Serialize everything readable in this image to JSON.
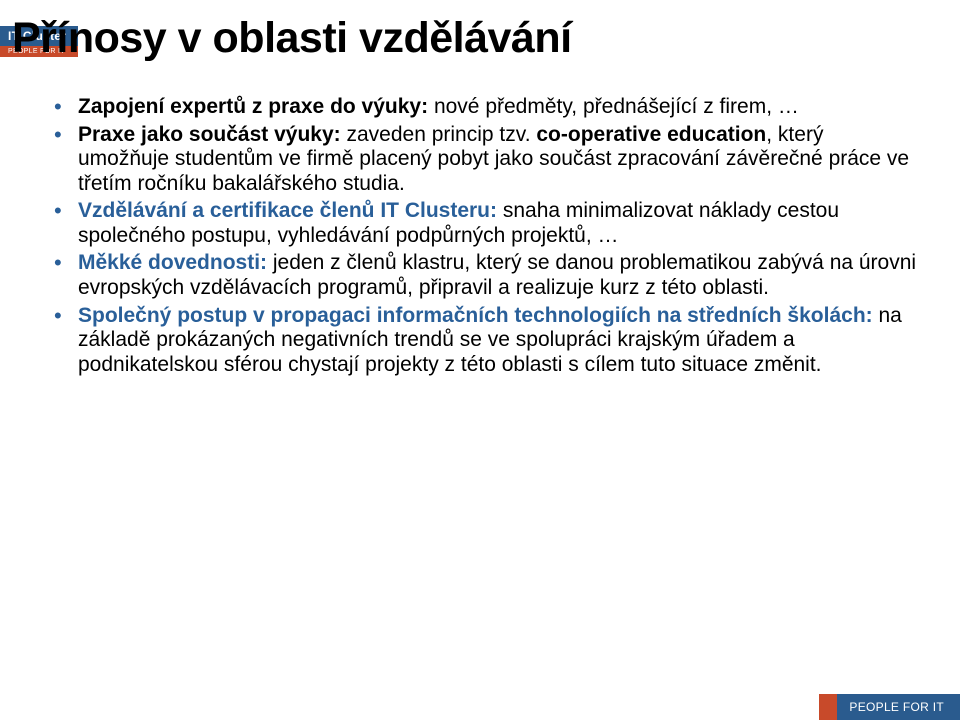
{
  "logo": {
    "top": "IT Cluster",
    "bottom": "PEOPLE FOR IT"
  },
  "title": "Přínosy v oblasti vzdělávání",
  "bullets": {
    "b0": {
      "head": "Zapojení expertů z praxe do výuky:",
      "tail": " nové předměty, přednášející z firem, …"
    },
    "b1": {
      "head": "Praxe jako součást výuky:",
      "tail": " zaveden princip tzv. ",
      "em": "co-operative education",
      "tail2": ", který umožňuje studentům ve firmě placený pobyt jako součást zpracování závěrečné práce ve třetím ročníku bakalářského studia."
    },
    "b2": {
      "head": "Vzdělávání a certifikace členů IT Clusteru:",
      "tail": " snaha minimalizovat náklady cestou společného postupu, vyhledávání podpůrných projektů, …"
    },
    "b3": {
      "head": "Měkké dovednosti:",
      "tail": " jeden z členů klastru, který se danou problematikou zabývá na úrovni evropských vzdělávacích programů, připravil a realizuje kurz z této oblasti."
    },
    "b4": {
      "head": "Společný postup v propagaci informačních technologiích na středních školách:",
      "tail": " na základě prokázaných negativních trendů se ve spolupráci krajským úřadem a podnikatelskou sférou chystají projekty z této oblasti s cílem tuto situace změnit."
    }
  },
  "footer": {
    "label": "PEOPLE FOR IT"
  }
}
